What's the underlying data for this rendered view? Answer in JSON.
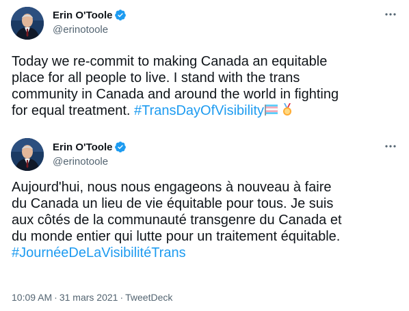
{
  "tweets": [
    {
      "author": {
        "display_name": "Erin O'Toole",
        "handle": "@erinotoole",
        "verified": true
      },
      "text": "Today we re-commit to making Canada an equitable\nplace for all people to live. I stand with the trans\ncommunity in Canada and around the world in fighting\nfor equal treatment. ",
      "hashtag": "#TransDayOfVisibility",
      "emoji": [
        "transgender-flag-icon",
        "medal-icon"
      ]
    },
    {
      "author": {
        "display_name": "Erin O'Toole",
        "handle": "@erinotoole",
        "verified": true
      },
      "text": "Aujourd'hui, nous nous engageons à nouveau à faire\ndu Canada un lieu de vie équitable pour tous. Je suis\naux côtés de la communauté transgenre du Canada et\ndu monde entier qui lutte pour un traitement équitable.\n",
      "hashtag": "#JournéeDeLaVisibilitéTrans",
      "meta": {
        "time": "10:09 AM",
        "separator": "·",
        "date": "31 mars 2021",
        "source": "TweetDeck"
      }
    }
  ],
  "colors": {
    "text": "#0f1419",
    "secondary": "#536471",
    "link": "#1d9bf0",
    "verified": "#1d9bf0"
  }
}
